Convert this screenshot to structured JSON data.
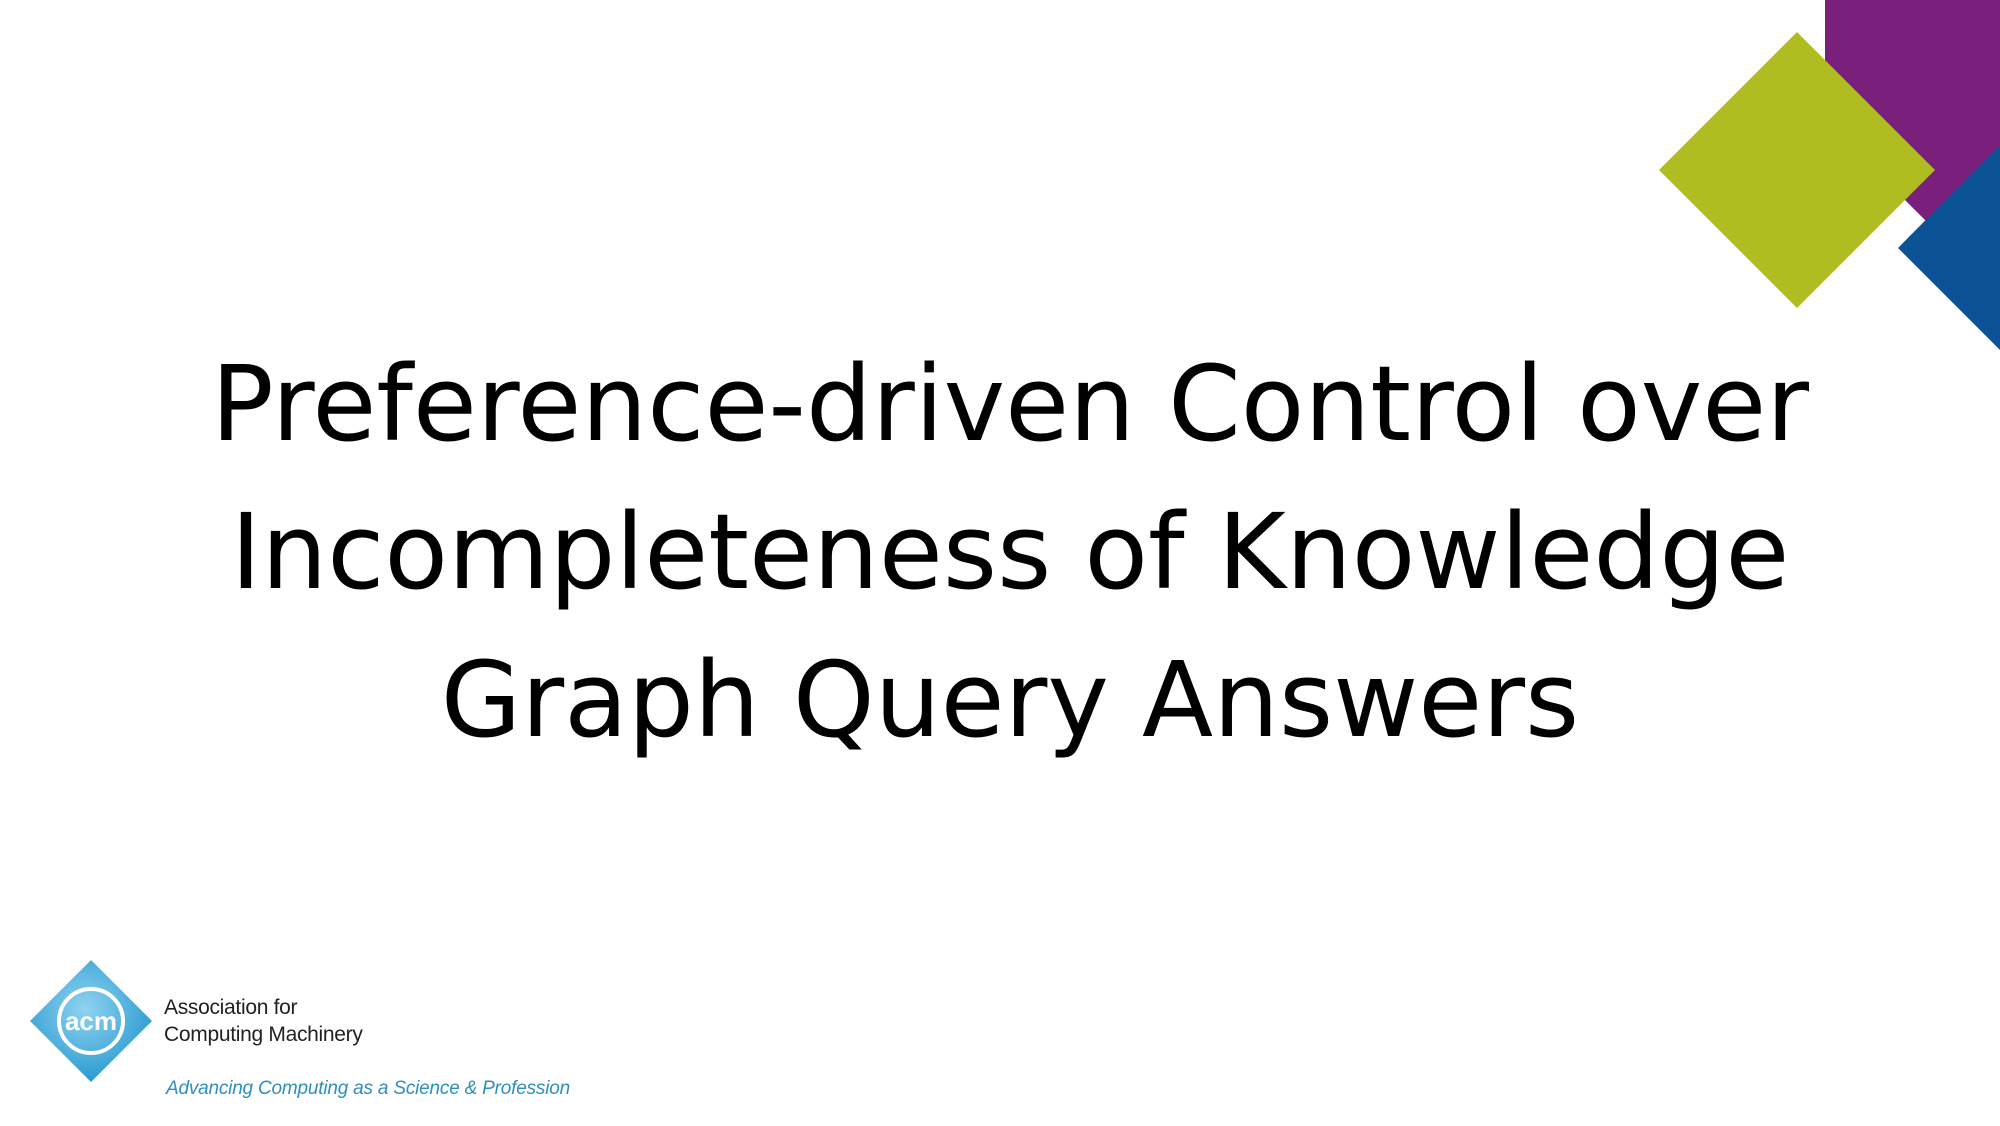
{
  "slide": {
    "title_lines": [
      "Preference-driven Control over",
      "Incompleteness of Knowledge",
      "Graph Query Answers"
    ]
  },
  "logo": {
    "mark_text": "acm",
    "name_lines": [
      "Association for",
      "Computing Machinery"
    ],
    "tagline": "Advancing Computing as a Science & Profession"
  },
  "colors": {
    "purple": "#7b1f7d",
    "lime": "#afbd21",
    "blue": "#0b5394",
    "acm_blue": "#3aa6d8",
    "acm_tagline": "#2e8fc0"
  }
}
